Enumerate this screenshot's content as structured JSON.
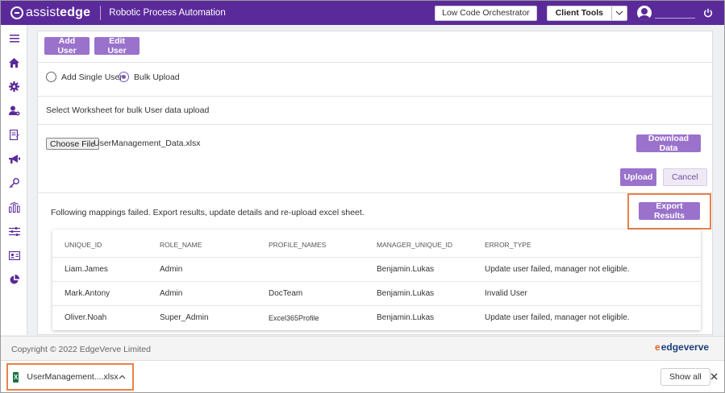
{
  "header": {
    "logo_assist": "assist",
    "logo_edge": "edge",
    "app_title": "Robotic Process Automation",
    "low_code_label": "Low Code Orchestrator",
    "client_tools_label": "Client Tools",
    "brand_color": "#5b2a9a"
  },
  "sidebar": {
    "items": [
      "menu-icon",
      "home-icon",
      "settings-icon",
      "user-settings-icon",
      "document-icon",
      "megaphone-icon",
      "key-icon",
      "analytics-icon",
      "filter-icon",
      "id-card-icon",
      "pie-chart-icon"
    ]
  },
  "toolbar": {
    "add_user_label": "Add User",
    "edit_user_label": "Edit User"
  },
  "mode": {
    "single_label": "Add Single User",
    "bulk_label": "Bulk Upload",
    "selected": "Bulk Upload"
  },
  "upload": {
    "instruction": "Select Worksheet for bulk User data upload",
    "choose_file_label": "Choose File",
    "file_name": "UserManagement_Data.xlsx",
    "download_label": "Download Data",
    "upload_label": "Upload",
    "cancel_label": "Cancel"
  },
  "results": {
    "message": "Following mappings failed. Export results, update details and re-upload excel sheet.",
    "export_label": "Export Results"
  },
  "table": {
    "columns": [
      "UNIQUE_ID",
      "ROLE_NAME",
      "PROFILE_NAMES",
      "MANAGER_UNIQUE_ID",
      "ERROR_TYPE"
    ],
    "rows": [
      [
        "Liam.James",
        "Admin",
        "",
        "Benjamin.Lukas",
        "Update user failed, manager not eligible."
      ],
      [
        "Mark.Antony",
        "Admin",
        "DocTeam",
        "Benjamin.Lukas",
        "Invalid User"
      ],
      [
        "Oliver.Noah",
        "Super_Admin",
        "Excel365Profile",
        "Benjamin.Lukas",
        "Update user failed, manager not eligible."
      ]
    ]
  },
  "footer": {
    "copyright": "Copyright © 2022 EdgeVerve Limited",
    "brand_e": "e",
    "brand_text": "edgeverve"
  },
  "download_bar": {
    "file_label": "UserManagement....xlsx",
    "show_all_label": "Show all"
  },
  "colors": {
    "accent": "#9a72cc",
    "highlight": "#e8824a"
  }
}
